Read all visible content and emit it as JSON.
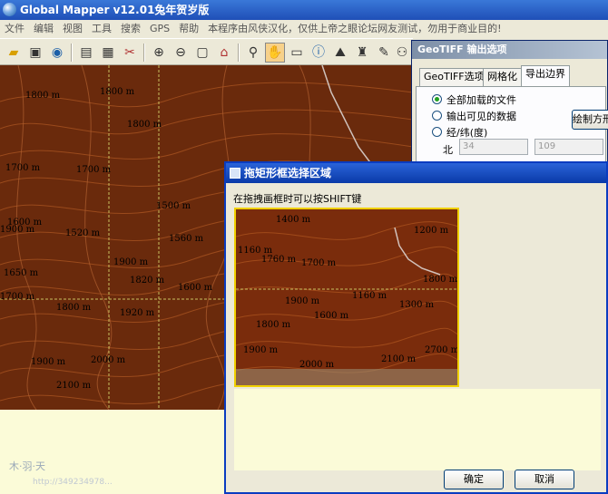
{
  "window": {
    "title": "Global Mapper v12.01兔年贺岁版"
  },
  "menu": [
    "文件",
    "编辑",
    "视图",
    "工具",
    "搜索",
    "GPS",
    "帮助",
    "本程序由风侠汉化，仅供上帝之眼论坛网友测试，勿用于商业目的!"
  ],
  "toolbar_icons": [
    "open-folder-icon",
    "save-icon",
    "globe-icon",
    "layers-icon",
    "config-icon",
    "tools-icon",
    "zoom-in-icon",
    "zoom-out-icon",
    "full-view-icon",
    "home-icon",
    "magnify-icon",
    "pan-hand-icon",
    "measure-icon",
    "info-icon",
    "path-profile-icon",
    "tower-icon",
    "digitizer-icon",
    "binoculars-icon"
  ],
  "map": {
    "contour_labels": [
      "1800 m",
      "1700 m",
      "1800 m",
      "1700 m",
      "1500 m",
      "1800 m",
      "1520 m",
      "1600 m",
      "1900 m",
      "1560 m",
      "1820 m",
      "1600 m",
      "1650 m",
      "1920 m",
      "1800 m",
      "1700 m",
      "1900 m",
      "2000 m",
      "2100 m",
      "1900 m"
    ]
  },
  "geotiff_dialog": {
    "title": "GeoTIFF 输出选项",
    "tabs": [
      "GeoTIFF选项",
      "网格化",
      "导出边界"
    ],
    "active_tab": 2,
    "options": [
      "全部加载的文件",
      "输出可见的数据",
      "经/纬(度)"
    ],
    "selected_option": 0,
    "draw_button": "绘制方形",
    "north_label": "北",
    "north_value": "34",
    "field2_value": "109"
  },
  "drag_dialog": {
    "title": "拖矩形框选择区域",
    "hint": "在拖拽画框时可以按SHIFT键",
    "ok": "确定",
    "cancel": "取消",
    "preview_labels": [
      "1400 m",
      "1200 m",
      "1160 m",
      "1760 m",
      "1700 m",
      "1800 m",
      "1900 m",
      "1160 m",
      "1300 m",
      "1800 m",
      "1600 m",
      "1900 m",
      "2000 m",
      "2100 m",
      "2700 m"
    ]
  },
  "watermark": {
    "line1": "木·羽·天",
    "line2": "http://349234978..."
  },
  "colors": {
    "map_bg": "#6a2a0c",
    "selection": "#f0d000",
    "title_active": "#1f4fb7"
  }
}
